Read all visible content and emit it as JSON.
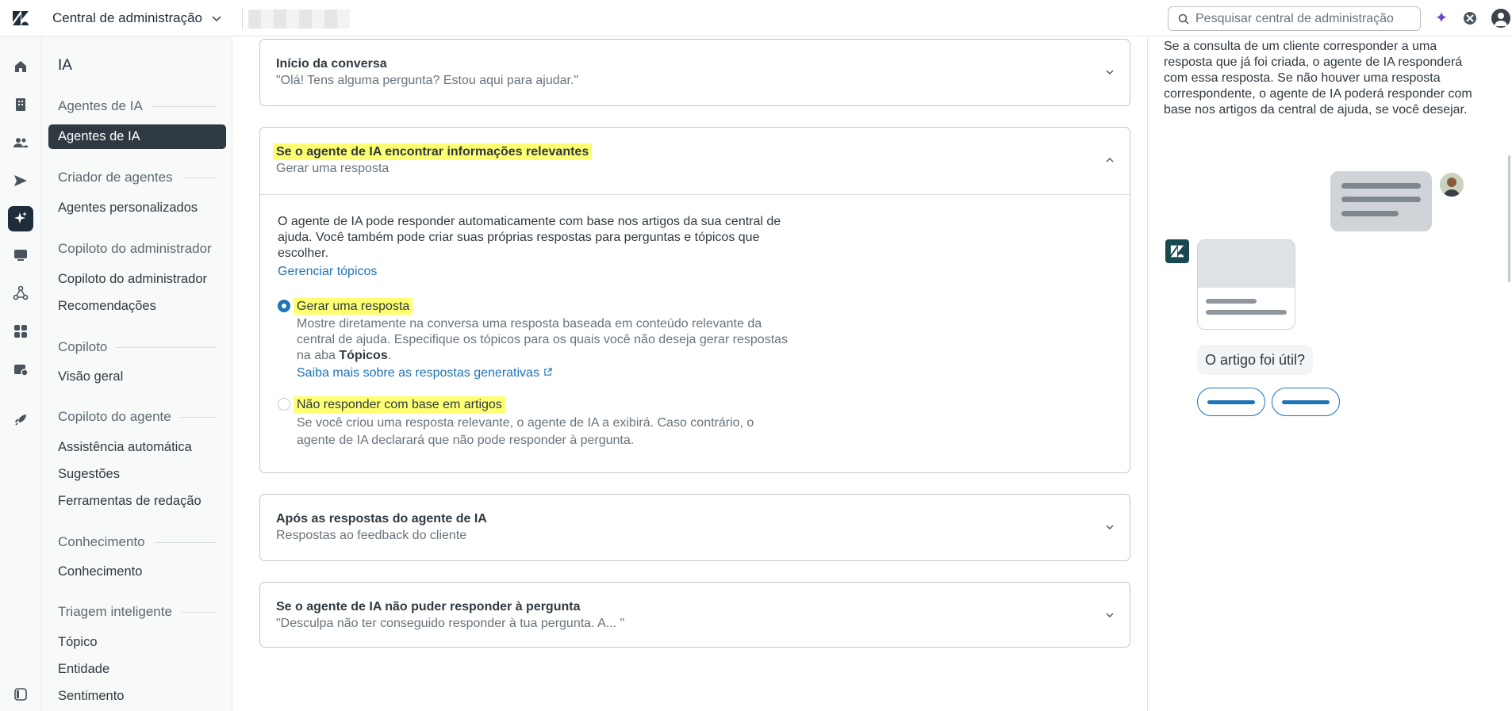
{
  "topbar": {
    "product_title": "Central de administração",
    "search_placeholder": "Pesquisar central de administração"
  },
  "sidebar": {
    "header": "IA",
    "sections": [
      {
        "label": "Agentes de IA",
        "items": [
          "Agentes de IA"
        ]
      },
      {
        "label": "Criador de agentes",
        "items": [
          "Agentes personalizados"
        ]
      },
      {
        "label": "Copiloto do administrador",
        "items": [
          "Copiloto do administrador",
          "Recomendações"
        ]
      },
      {
        "label": "Copiloto",
        "items": [
          "Visão geral"
        ]
      },
      {
        "label": "Copiloto do agente",
        "items": [
          "Assistência automática",
          "Sugestões",
          "Ferramentas de redação"
        ]
      },
      {
        "label": "Conhecimento",
        "items": [
          "Conhecimento"
        ]
      },
      {
        "label": "Triagem inteligente",
        "items": [
          "Tópico",
          "Entidade",
          "Sentimento"
        ]
      }
    ]
  },
  "main": {
    "card1": {
      "title": "Início da conversa",
      "subtitle": "\"Olá! Tens alguma pergunta? Estou aqui para ajudar.\""
    },
    "card2": {
      "title": "Se o agente de IA encontrar informações relevantes",
      "subtitle": "Gerar uma resposta",
      "body": "O agente de IA pode responder automaticamente com base nos artigos da sua central de ajuda. Você também pode criar suas próprias respostas para perguntas e tópicos que escolher.",
      "manage_link": "Gerenciar tópicos",
      "option1_label": "Gerar uma resposta",
      "option1_desc": "Mostre diretamente na conversa uma resposta baseada em conteúdo relevante da central de ajuda. Especifique os tópicos para os quais você não deseja gerar respostas na aba",
      "option1_desc_bold": "Tópicos",
      "option1_desc_end": ".",
      "option1_link": "Saiba mais sobre as respostas generativas",
      "option1_selected": true,
      "option2_label": "Não responder com base em artigos",
      "option2_desc": "Se você criou uma resposta relevante, o agente de IA a exibirá. Caso contrário, o agente de IA declarará que não pode responder à pergunta."
    },
    "card3": {
      "title": "Após as respostas do agente de IA",
      "subtitle": "Respostas ao feedback do cliente"
    },
    "card4": {
      "title": "Se o agente de IA não puder responder à pergunta",
      "subtitle": "\"Desculpa não ter conseguido responder à tua pergunta. A... \""
    }
  },
  "preview": {
    "description": "Se a consulta de um cliente corresponder a uma resposta que já foi criada, o agente de IA responderá com essa resposta. Se não houver uma resposta correspondente, o agente de IA poderá responder com base nos artigos da central de ajuda, se você desejar.",
    "question": "O artigo foi útil?"
  },
  "colors": {
    "accent": "#1f73b7",
    "highlight": "#ffff72",
    "rail_active": "#1f2d3a"
  }
}
